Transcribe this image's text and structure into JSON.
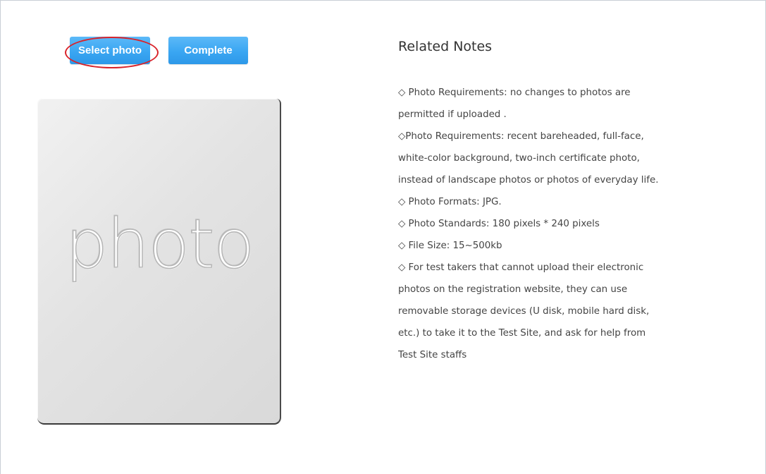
{
  "toolbar": {
    "select_photo_label": "Select photo",
    "complete_label": "Complete"
  },
  "photo_placeholder": {
    "text": "photo"
  },
  "notes": {
    "title": "Related Notes",
    "lines": [
      "◇ Photo Requirements: no changes to photos are",
      "permitted if uploaded .",
      "◇Photo Requirements: recent bareheaded, full-face,",
      "white-color background, two-inch certificate photo,",
      "instead of landscape photos or photos of everyday life.",
      "◇ Photo Formats: JPG.",
      "◇ Photo Standards: 180 pixels * 240 pixels",
      "◇ File Size: 15~500kb",
      "◇ For test takers that cannot upload their electronic",
      "photos on the registration website, they can use",
      "removable storage devices (U disk, mobile hard disk,",
      "etc.) to take it to the Test Site, and ask for help from",
      "Test Site staffs"
    ]
  },
  "colors": {
    "button_blue": "#3aa6f2",
    "highlight_red": "#d9232a"
  }
}
